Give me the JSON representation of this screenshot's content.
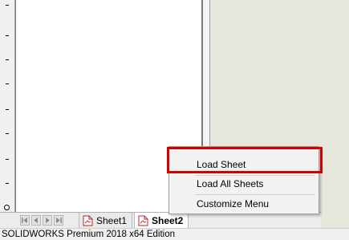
{
  "tabs": [
    {
      "label": "Sheet1",
      "active": false
    },
    {
      "label": "Sheet2",
      "active": true
    }
  ],
  "status": {
    "text": "SOLIDWORKS Premium 2018 x64 Edition"
  },
  "context_menu": {
    "items": [
      {
        "label": "Load Sheet"
      },
      {
        "label": "Load All Sheets"
      },
      {
        "label": "Customize Menu"
      }
    ],
    "highlighted_item": "Load Sheet",
    "highlight_color": "#d40000"
  },
  "icons": {
    "tab_icon": "drawing-sheet-icon",
    "nav": [
      "first-sheet-icon",
      "previous-sheet-icon",
      "next-sheet-icon",
      "last-sheet-icon"
    ]
  }
}
